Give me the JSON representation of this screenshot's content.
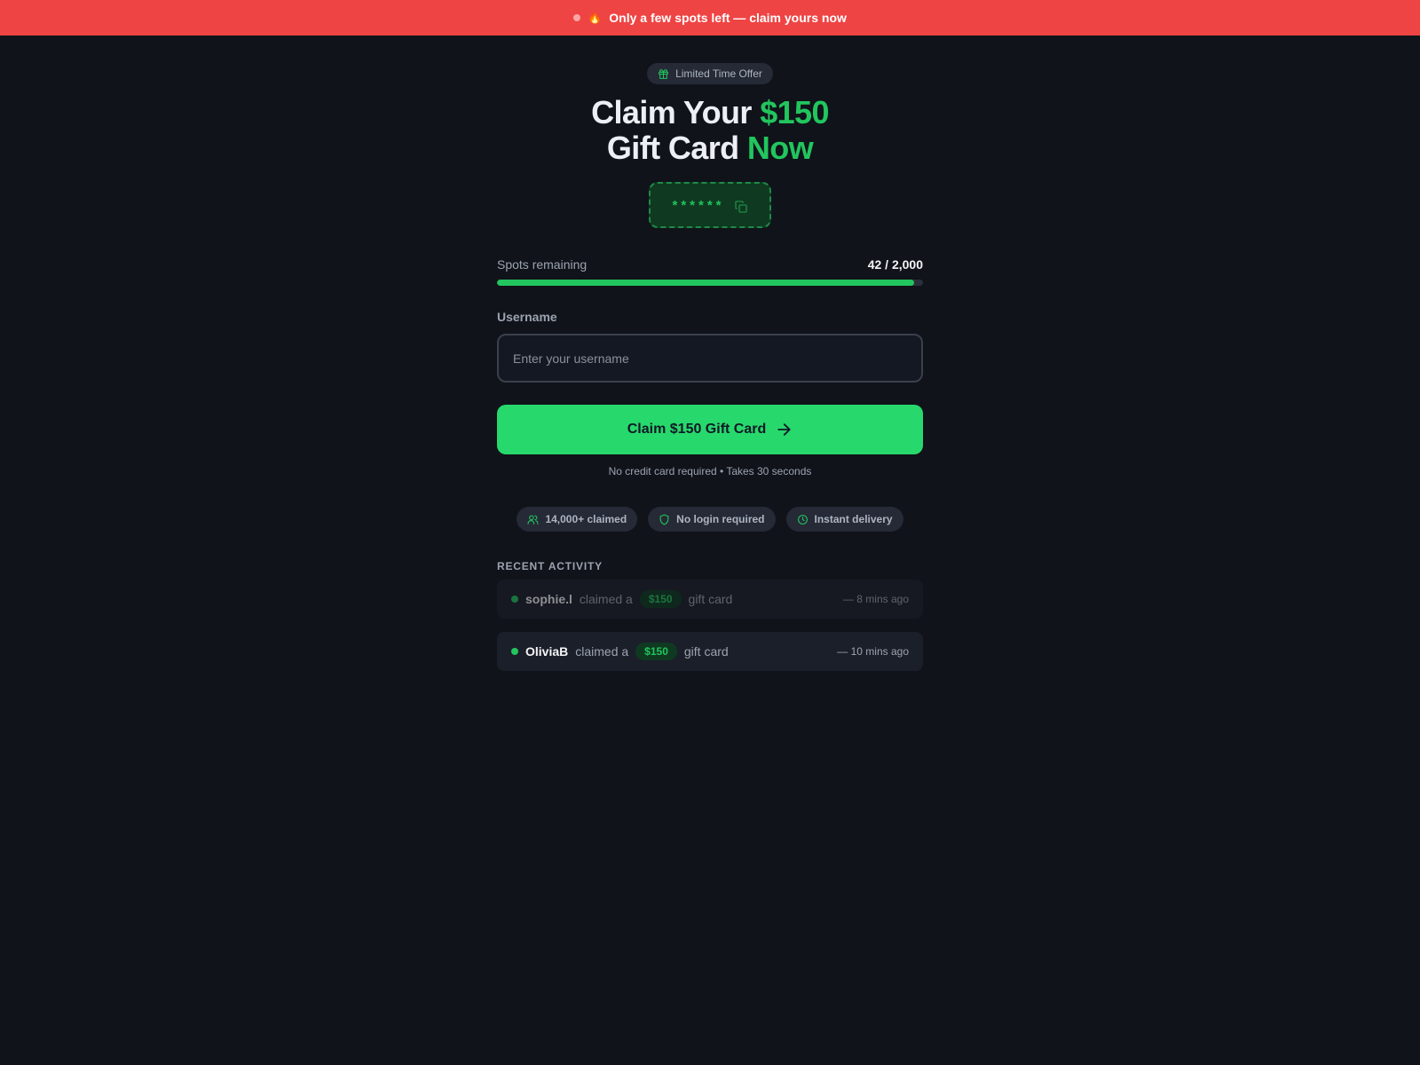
{
  "banner": {
    "emoji": "🔥",
    "text": "Only a few spots left — claim yours now"
  },
  "badge": {
    "icon": "gift-icon",
    "label": "Limited Time Offer"
  },
  "headline": {
    "part1": "Claim Your ",
    "highlight1": "$150",
    "part2": "Gift Card ",
    "highlight2": "Now"
  },
  "code": {
    "masked": "******",
    "copy_icon": "copy-icon"
  },
  "spots": {
    "label": "Spots remaining",
    "count_text": "42 / 2,000",
    "progress_fraction": 0.979
  },
  "form": {
    "username_label": "Username",
    "username_placeholder": "Enter your username",
    "username_value": ""
  },
  "cta": {
    "label": "Claim $150 Gift Card",
    "icon": "arrow-right-icon"
  },
  "subnote": "No credit card required • Takes 30 seconds",
  "trust": [
    {
      "icon": "users-icon",
      "label": "14,000+ claimed"
    },
    {
      "icon": "shield-icon",
      "label": "No login required"
    },
    {
      "icon": "clock-icon",
      "label": "Instant delivery"
    }
  ],
  "activity": {
    "title": "RECENT ACTIVITY",
    "items": [
      {
        "user": "sophie.l",
        "action": "claimed a",
        "amount": "$150",
        "suffix": "gift card",
        "time": "— 8 mins ago"
      },
      {
        "user": "OliviaB",
        "action": "claimed a",
        "amount": "$150",
        "suffix": "gift card",
        "time": "— 10 mins ago"
      }
    ]
  },
  "colors": {
    "banner": "#ef4444",
    "accent": "#22c55e",
    "cta": "#27d96c",
    "background": "#10131a"
  }
}
